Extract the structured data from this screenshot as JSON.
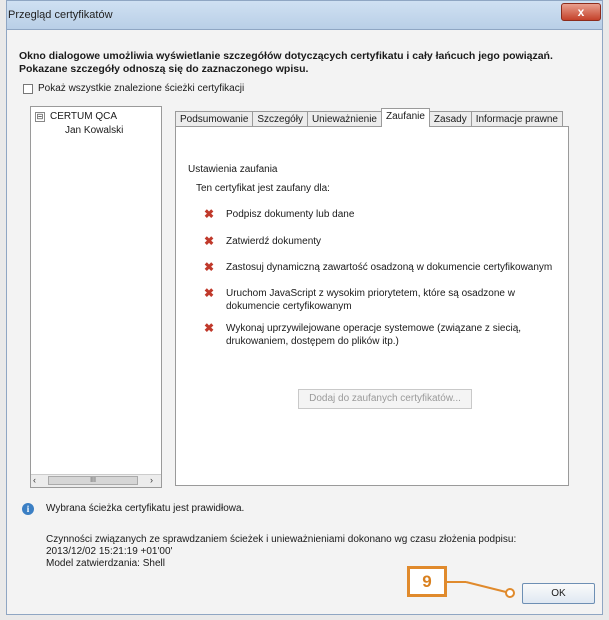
{
  "window": {
    "title": "Przegląd certyfikatów",
    "close_symbol": "x"
  },
  "description": "Okno dialogowe umożliwia wyświetlanie szczegółów dotyczących certyfikatu i cały łańcuch jego powiązań. Pokazane szczegóły odnoszą się do zaznaczonego wpisu.",
  "show_all_paths": {
    "label": "Pokaż wszystkie znalezione ścieżki certyfikacji",
    "checked": false
  },
  "tree": {
    "root": "CERTUM QCA",
    "root_toggle": "⊟",
    "child": "Jan Kowalski",
    "scroll_left": "‹",
    "scroll_right": "›",
    "scroll_thumb": "III"
  },
  "tabs": [
    {
      "label": "Podsumowanie",
      "active": false
    },
    {
      "label": "Szczegóły",
      "active": false
    },
    {
      "label": "Unieważnienie",
      "active": false
    },
    {
      "label": "Zaufanie",
      "active": true
    },
    {
      "label": "Zasady",
      "active": false
    },
    {
      "label": "Informacje prawne",
      "active": false
    }
  ],
  "trust": {
    "settings_title": "Ustawienia zaufania",
    "trusted_for": "Ten certyfikat jest zaufany dla:",
    "items": [
      "Podpisz dokumenty lub dane",
      "Zatwierdź dokumenty",
      "Zastosuj dynamiczną zawartość osadzoną w dokumencie certyfikowanym",
      "Uruchom JavaScript z wysokim priorytetem, które są osadzone w dokumencie certyfikowanym",
      "Wykonaj uprzywilejowane operacje systemowe (związane z siecią, drukowaniem, dostępem do plików itp.)"
    ],
    "add_button": "Dodaj do zaufanych certyfikatów..."
  },
  "status": {
    "valid": "Wybrana ścieżka certyfikatu jest prawidłowa.",
    "line1": "Czynności związanych ze sprawdzaniem ścieżek i unieważnieniami dokonano wg czasu złożenia podpisu:",
    "line2": "2013/12/02 15:21:19 +01'00'",
    "line3": "Model zatwierdzania: Shell",
    "info_symbol": "i"
  },
  "callout_number": "9",
  "ok_label": "OK",
  "colors": {
    "callout": "#e08a2c",
    "deny_icon": "#c0392b",
    "info_icon": "#3b7fc4"
  }
}
